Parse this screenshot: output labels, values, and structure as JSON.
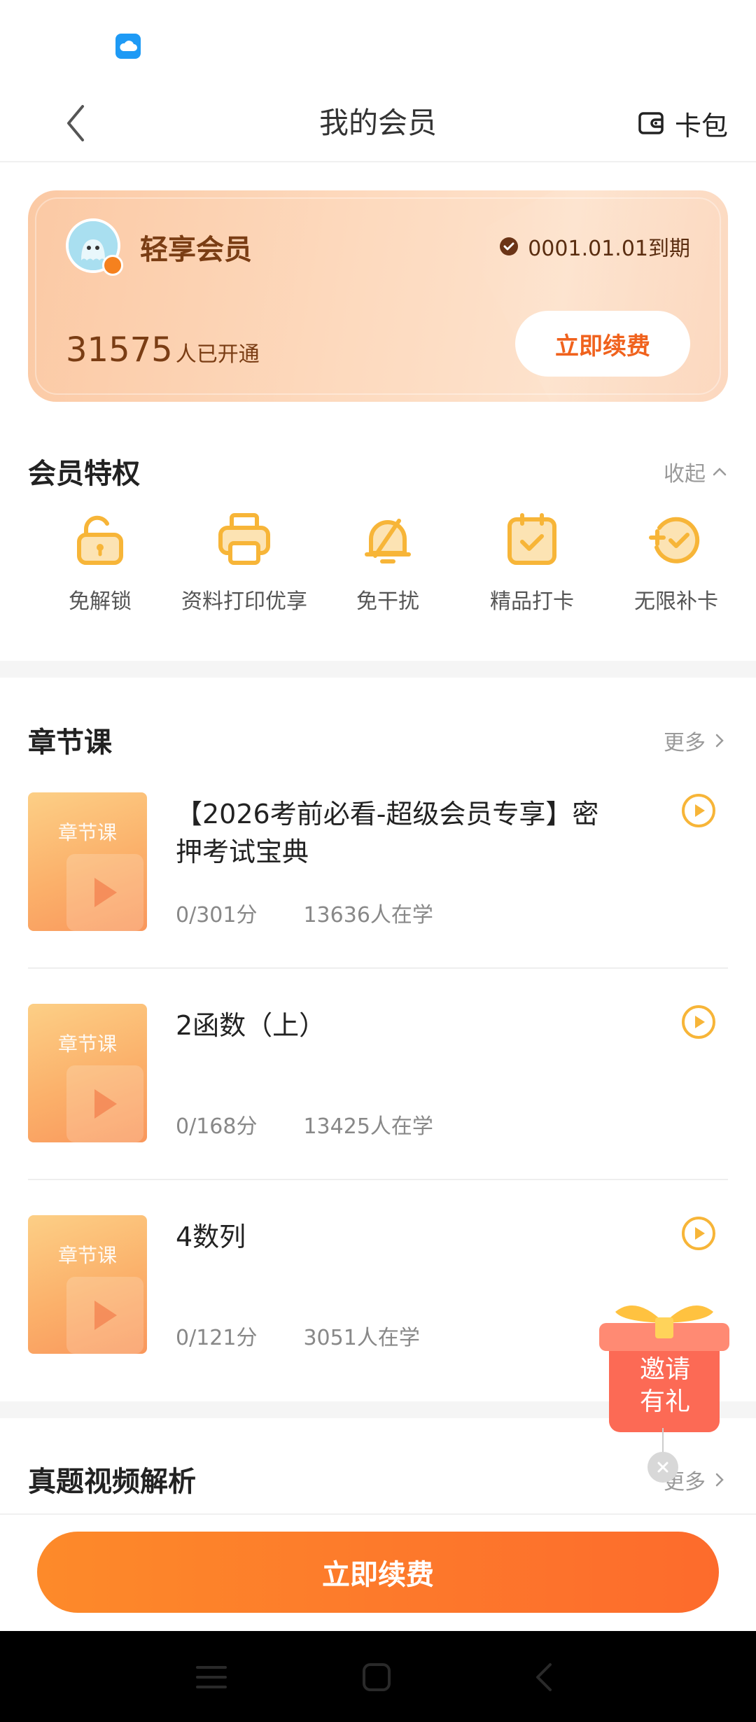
{
  "status_bar": {
    "app_icon": "cloud-icon"
  },
  "nav": {
    "title": "我的会员",
    "back_icon": "back-arrow-icon",
    "wallet_label": "卡包",
    "wallet_icon": "wallet-icon"
  },
  "member_card": {
    "level": "轻享会员",
    "expiry": "0001.01.01到期",
    "member_count": "31575",
    "member_count_suffix": "人已开通",
    "renew_label": "立即续费"
  },
  "privileges": {
    "title": "会员特权",
    "collapse_label": "收起",
    "items": [
      {
        "label": "免解锁",
        "icon": "unlock-icon"
      },
      {
        "label": "资料打印优享",
        "icon": "printer-icon"
      },
      {
        "label": "免干扰",
        "icon": "bell-off-icon"
      },
      {
        "label": "精品打卡",
        "icon": "calendar-check-icon"
      },
      {
        "label": "无限补卡",
        "icon": "refill-check-icon"
      }
    ]
  },
  "chapter_courses": {
    "title": "章节课",
    "more_label": "更多",
    "items": [
      {
        "thumb_label": "章节课",
        "title": "【2026考前必看-超级会员专享】密押考试宝典",
        "score": "0/301分",
        "learners": "13636人在学"
      },
      {
        "thumb_label": "章节课",
        "title": "2函数（上）",
        "score": "0/168分",
        "learners": "13425人在学"
      },
      {
        "thumb_label": "章节课",
        "title": "4数列",
        "score": "0/121分",
        "learners": "3051人在学"
      }
    ]
  },
  "video_analysis": {
    "title": "真题视频解析",
    "more_label": "更多"
  },
  "invite": {
    "line1": "邀请",
    "line2": "有礼"
  },
  "bottom": {
    "renew_label": "立即续费"
  },
  "colors": {
    "accent": "#fd7a2b",
    "icon_yellow": "#f7b538",
    "card_bg": "#fdd9bd"
  }
}
